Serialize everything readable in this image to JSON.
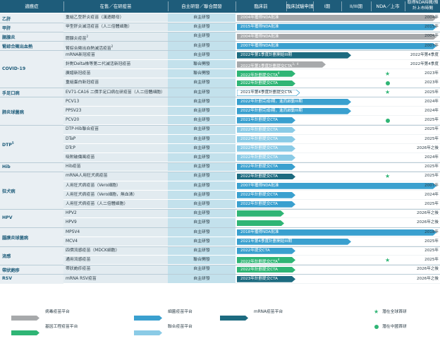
{
  "header": {
    "disease": "適應症",
    "vaccine": "在售／在研疫苗",
    "dev": "自主研發／聯合開發",
    "preclinical": "臨床前",
    "ind": "臨床試驗申請",
    "p1": "I期",
    "p23": "II/III期",
    "nda": "NDA／上市",
    "time": "取得NDA時間/預計上市時間"
  },
  "groups": [
    {
      "label": "乙肝",
      "row": 0
    },
    {
      "label": "甲肝",
      "row": 1
    },
    {
      "label": "腮腺炎",
      "row": 2
    },
    {
      "label": "腎綜合徵出血熱",
      "row": 3
    },
    {
      "label": "COVID-19",
      "row": 6
    },
    {
      "label": "手足口病",
      "row": 9
    },
    {
      "label": "肺炎球菌病",
      "row": 11
    },
    {
      "label": "DTP",
      "sup": "5",
      "row": 14
    },
    {
      "label": "Hib",
      "row": 17
    },
    {
      "label": "狂犬病",
      "row": 19
    },
    {
      "label": "HPV",
      "row": 22
    },
    {
      "label": "腦膜炎球菌病",
      "row": 24
    },
    {
      "label": "流感",
      "row": 26
    },
    {
      "label": "帶狀皰疹",
      "row": 28
    },
    {
      "label": "RSV",
      "row": 29
    }
  ],
  "rows": [
    {
      "vaccine": "重組乙型肝炎疫苗（漢遜酵母）",
      "dev": "自主研發",
      "bar": "2004年獲得NDA批准",
      "platform": "gray",
      "end": 0.99,
      "time": "2004年"
    },
    {
      "vaccine": "甲型肝炎滅活疫苗（人二倍體細胞）",
      "dev": "自主研發",
      "bar": "2015年獲得NDA批准",
      "platform": "blue",
      "end": 0.99,
      "time": "2015年"
    },
    {
      "vaccine": "腮腺炎疫苗",
      "sup": "2",
      "dev": "自主研發",
      "bar": "2004年獲得NDA批准",
      "platform": "gray",
      "end": 0.99,
      "time": "2004年"
    },
    {
      "vaccine": "腎綜合徵出血熱滅活疫苗",
      "sup": "2",
      "dev": "自主研發",
      "bar": "2007年獲得NDA批准",
      "platform": "blue",
      "end": 0.99,
      "time": "2007年"
    },
    {
      "vaccine": "mRNA新冠疫苗",
      "dev": "自主研發",
      "bar": "2022年第1季度計劃開始III期",
      "platform": "navy",
      "end": 0.565,
      "time": "2022年第4季度"
    },
    {
      "vaccine": "針對Delta株等第二代滅活新冠疫苗",
      "dev": "聯合開發",
      "bar": "2022年第1季度計劃提交CTA",
      "sup": "3，4",
      "platform": "gray",
      "end": 0.442,
      "time": "2022年第4季度"
    },
    {
      "vaccine": "廣譜新冠疫苗",
      "dev": "聯合開發",
      "bar": "2022年計劃提交CTA",
      "sup": "4",
      "platform": "green",
      "end": 0.29,
      "time": "2023年",
      "mark": "star"
    },
    {
      "vaccine": "重組蛋白新冠疫苗",
      "dev": "自主研發",
      "bar": "2022年計劃提交CTA",
      "platform": "green",
      "end": 0.29,
      "time": "2023年",
      "mark": "dot"
    },
    {
      "vaccine": "EV71-CA16 二價手足口病在研疫苗（人二倍體細胞）",
      "dev": "自主研發",
      "bar": "2021年第4季度計劃提交CTA",
      "platform": "blue",
      "end": 0.31,
      "time": "2025年",
      "mark": "star",
      "outline": true
    },
    {
      "vaccine": "PCV13",
      "dev": "自主研發",
      "bar": "2022年計劃完成I期，進而啟動III期",
      "platform": "blue",
      "end": 0.565,
      "time": "2024年"
    },
    {
      "vaccine": "PPSV23",
      "dev": "自主研發",
      "bar": "2022年計劃完成I期，進而啟動III期",
      "platform": "blue",
      "end": 0.565,
      "time": "2024年"
    },
    {
      "vaccine": "PCV20",
      "dev": "自主研發",
      "bar": "2021年計劃提交CTA",
      "platform": "blue",
      "end": 0.29,
      "time": "2025年",
      "mark": "dot"
    },
    {
      "vaccine": "DTP-Hib聯合疫苗",
      "dev": "自主研發",
      "bar": "2022年計劃提交CTA",
      "platform": "light",
      "end": 0.29,
      "time": "2025年"
    },
    {
      "vaccine": "DTaP",
      "dev": "自主研發",
      "bar": "2022年計劃提交CTA",
      "platform": "light",
      "end": 0.29,
      "time": "2025年"
    },
    {
      "vaccine": "DTcP",
      "dev": "自主研發",
      "bar": "2022年計劃提交CTA",
      "platform": "light",
      "end": 0.29,
      "time": "2026年之後"
    },
    {
      "vaccine": "吸附破傷風疫苗",
      "dev": "自主研發",
      "bar": "2022年計劃提交CTA",
      "platform": "light",
      "end": 0.29,
      "time": "2024年"
    },
    {
      "vaccine": "Hib疫苗",
      "dev": "自主研發",
      "bar": "2022年計劃提交CTA",
      "platform": "blue",
      "end": 0.29,
      "time": "2025年"
    },
    {
      "vaccine": "mRNA人用狂犬病疫苗",
      "dev": "自主研發",
      "bar": "2022年計劃提交CTA",
      "platform": "navy",
      "end": 0.29,
      "time": "2025年",
      "mark": "star"
    },
    {
      "vaccine": "人用狂犬病疫苗（Vero細胞）",
      "dev": "自主研發",
      "bar": "2007年獲得NDA批准",
      "platform": "blue",
      "end": 0.99,
      "time": "2007年"
    },
    {
      "vaccine": "人用狂犬病疫苗（Vero細胞，無血清）",
      "dev": "自主研發",
      "bar": "2022年計劃提交CTA",
      "platform": "blue",
      "end": 0.29,
      "time": "2024年"
    },
    {
      "vaccine": "人用狂犬病疫苗（人二倍體細胞）",
      "dev": "自主研發",
      "bar": "2022年計劃提交CTA",
      "platform": "blue",
      "end": 0.29,
      "time": "2025年"
    },
    {
      "vaccine": "HPV2",
      "dev": "自主研發",
      "bar": "",
      "platform": "green",
      "end": 0.235,
      "time": "2026年之後"
    },
    {
      "vaccine": "HPV9",
      "dev": "自主研發",
      "bar": "",
      "platform": "green",
      "end": 0.235,
      "time": "2026年之後"
    },
    {
      "vaccine": "MPSV4",
      "dev": "自主研發",
      "bar": "2018年獲得NDA批准",
      "platform": "blue",
      "end": 0.99,
      "time": "2018年"
    },
    {
      "vaccine": "MCV4",
      "dev": "自主研發",
      "bar": "2021年第4季度計劃開始III期",
      "platform": "blue",
      "end": 0.565,
      "time": "2025年"
    },
    {
      "vaccine": "四價流感疫苗（MDCK細胞）",
      "dev": "自主研發",
      "bar": "2022年提交CTA",
      "platform": "blue",
      "end": 0.29,
      "time": "2025年"
    },
    {
      "vaccine": "通用流感疫苗",
      "dev": "聯合開發",
      "bar": "2022年計劃提交CTA",
      "sup": "4",
      "platform": "green",
      "end": 0.29,
      "time": "2025年",
      "mark": "star"
    },
    {
      "vaccine": "帶狀皰疹疫苗",
      "dev": "自主研發",
      "bar": "2022年計劃提交CTA",
      "platform": "green",
      "end": 0.29,
      "time": "2026年之後"
    },
    {
      "vaccine": "mRNA RSV疫苗",
      "dev": "自主研發",
      "bar": "2023年計劃提交CTA",
      "platform": "navy",
      "end": 0.29,
      "time": "2026年之後"
    }
  ],
  "platform_colors": {
    "gray": "#a7a9ab",
    "blue": "#3aa0cf",
    "navy": "#1d6b80",
    "green": "#2fb575",
    "light": "#8bcbe6"
  },
  "legend": [
    {
      "label": "病毒疫苗平台",
      "platform": "gray"
    },
    {
      "label": "細菌疫苗平台",
      "platform": "blue"
    },
    {
      "label": "mRNA疫苗平台",
      "platform": "navy"
    },
    {
      "label": "潛在全球首研",
      "mark": "star"
    },
    {
      "label": "基因工程疫苗平台",
      "platform": "green"
    },
    {
      "label": "聯合疫苗平台",
      "platform": "light"
    },
    {
      "label": "潛在中國首研",
      "mark": "dot"
    }
  ]
}
